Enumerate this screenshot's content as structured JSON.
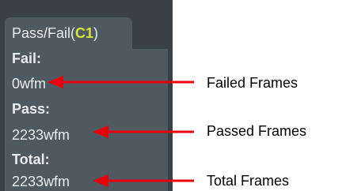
{
  "panel": {
    "title_prefix": "Pass/Fail(",
    "channel": "C1",
    "title_suffix": ")",
    "fail_label": "Fail:",
    "fail_value": "0wfm",
    "pass_label": "Pass:",
    "pass_value": "2233wfm",
    "total_label": "Total:",
    "total_value": "2233wfm"
  },
  "annotations": {
    "failed": "Failed Frames",
    "passed": "Passed Frames",
    "total": "Total Frames"
  },
  "colors": {
    "panel_bg": "#3a4146",
    "tab_bg": "#4f5a60",
    "text": "#e9ecec",
    "channel": "#d6e43a",
    "arrow": "#e8000d"
  }
}
